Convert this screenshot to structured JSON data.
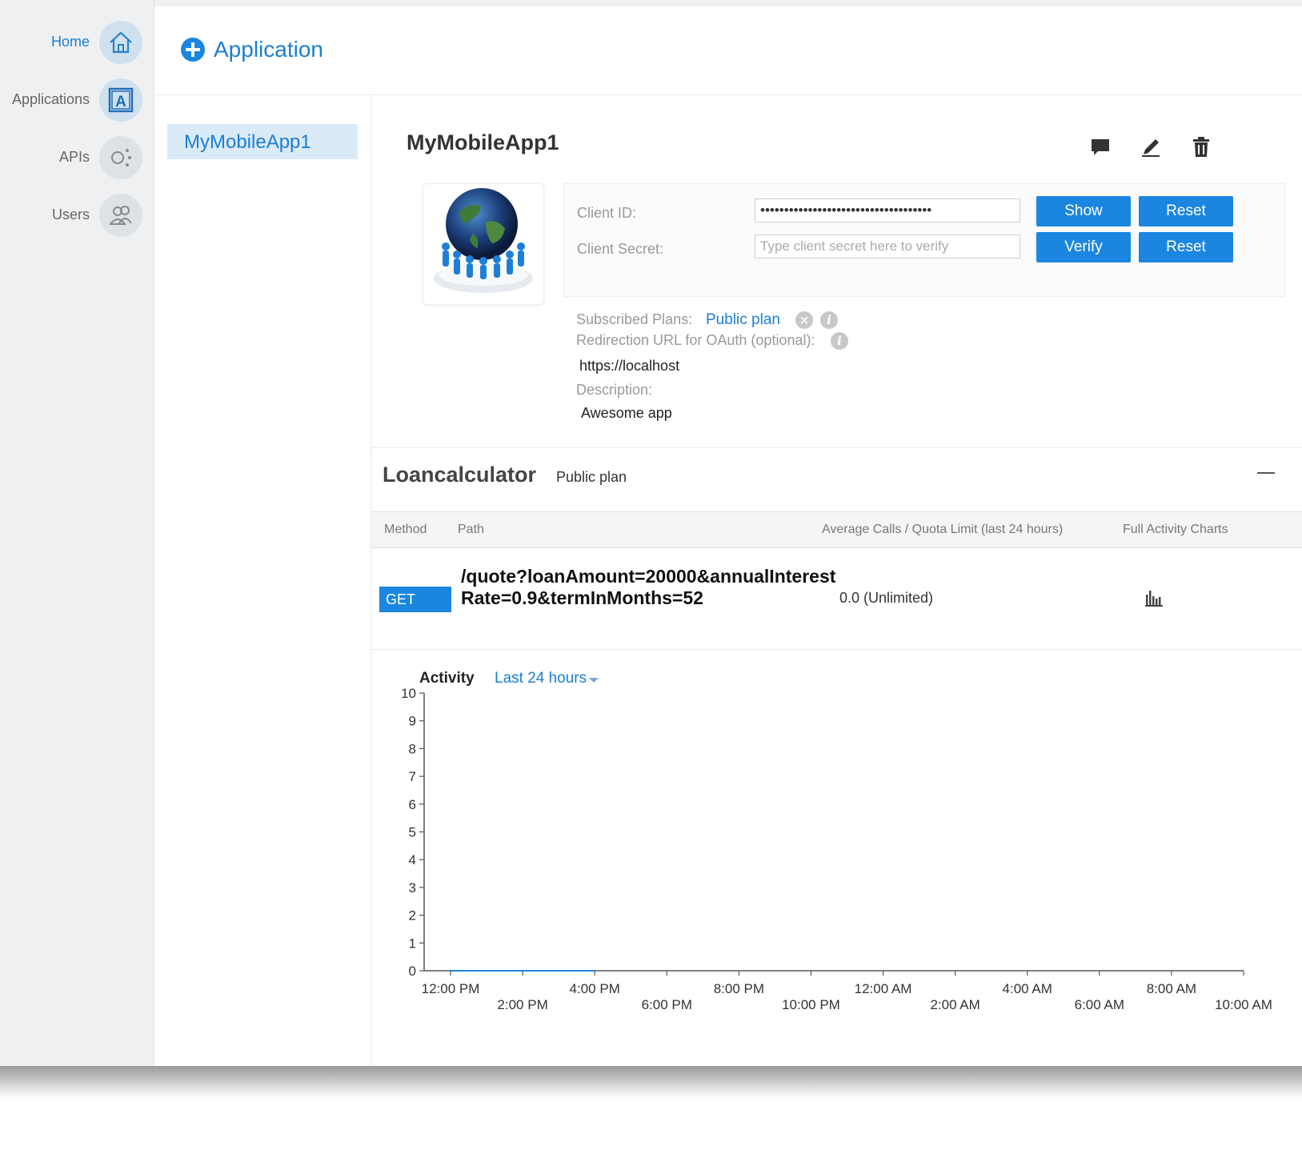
{
  "nav": {
    "items": [
      {
        "label": "Home",
        "icon": "home-icon"
      },
      {
        "label": "Applications",
        "icon": "applications-icon"
      },
      {
        "label": "APIs",
        "icon": "apis-icon"
      },
      {
        "label": "Users",
        "icon": "users-icon"
      }
    ]
  },
  "header": {
    "title": "Application",
    "icon": "plus-circle-icon"
  },
  "app_list": {
    "items": [
      {
        "label": "MyMobileApp1"
      }
    ]
  },
  "app": {
    "name": "MyMobileApp1",
    "actions": [
      "comment-icon",
      "edit-icon",
      "trash-icon"
    ],
    "avatar_icon": "globe-icon",
    "credentials": {
      "client_id_label": "Client ID:",
      "client_id_value": "••••••••••••••••••••••••••••••••••••",
      "client_secret_label": "Client Secret:",
      "client_secret_placeholder": "Type client secret here to verify",
      "show_label": "Show",
      "reset_label": "Reset",
      "verify_label": "Verify",
      "reset2_label": "Reset"
    },
    "subscribed_plans_label": "Subscribed Plans:",
    "subscribed_plan": "Public plan",
    "redirect_label": "Redirection URL for OAuth (optional):",
    "redirect_value": "https://localhost",
    "description_label": "Description:",
    "description_value": "Awesome app"
  },
  "api": {
    "name": "Loancalculator",
    "plan": "Public plan",
    "columns": [
      "Method",
      "Path",
      "Average Calls / Quota Limit (last 24 hours)",
      "Full Activity Charts"
    ],
    "rows": [
      {
        "method": "GET",
        "path": "/quote?loanAmount=20000&annualInterestRate=0.9&termInMonths=52",
        "calls": "0.0 (Unlimited)"
      }
    ]
  },
  "activity": {
    "label": "Activity",
    "range": "Last 24 hours"
  },
  "chart_data": {
    "type": "line",
    "x": [
      "12:00 PM",
      "2:00 PM",
      "4:00 PM",
      "6:00 PM",
      "8:00 PM",
      "10:00 PM",
      "12:00 AM",
      "2:00 AM",
      "4:00 AM",
      "6:00 AM",
      "8:00 AM",
      "10:00 AM"
    ],
    "series": [
      {
        "values": [
          0,
          0,
          0,
          null,
          null,
          null,
          null,
          null,
          null,
          null,
          null,
          null
        ]
      }
    ],
    "ylim": [
      0,
      10
    ],
    "yticks": [
      0,
      1,
      2,
      3,
      4,
      5,
      6,
      7,
      8,
      9,
      10
    ],
    "grid": false,
    "colors": {
      "axis": "#555555",
      "series": "#1a86e0"
    }
  }
}
